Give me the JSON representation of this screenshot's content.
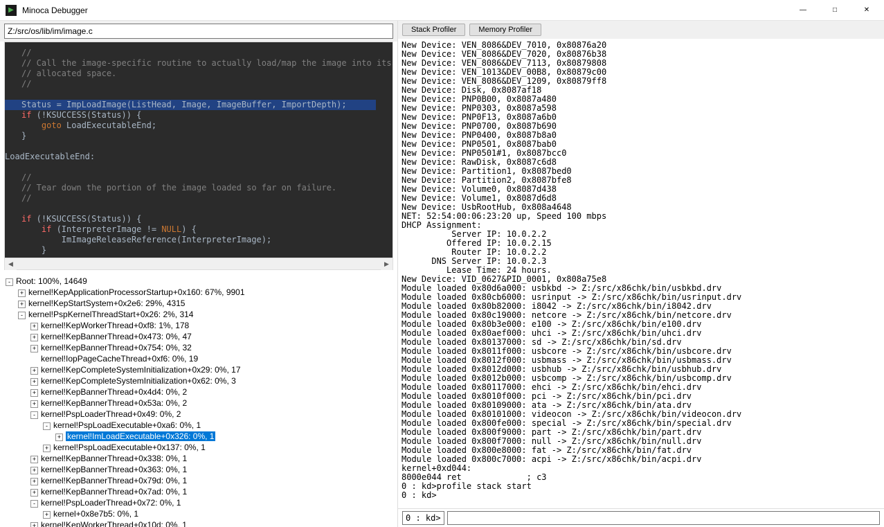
{
  "window": {
    "title": "Minoca Debugger",
    "icon_glyph": "▶"
  },
  "source": {
    "path": "Z:/src/os/lib/im/image.c"
  },
  "code_lines": [
    {
      "cls": "cm",
      "t": "//"
    },
    {
      "cls": "cm",
      "t": "// Call the image-specific routine to actually load/map the image into its"
    },
    {
      "cls": "cm",
      "t": "// allocated space."
    },
    {
      "cls": "cm",
      "t": "//"
    },
    {
      "cls": "",
      "t": ""
    },
    {
      "cls": "hl",
      "t": "Status = ImpLoadImage(ListHead, Image, ImageBuffer, ImportDepth);"
    },
    {
      "cls": "kw2",
      "t": "if (!KSUCCESS(Status)) {"
    },
    {
      "cls": "kw",
      "t": "    goto LoadExecutableEnd;"
    },
    {
      "cls": "",
      "t": "}"
    },
    {
      "cls": "",
      "t": ""
    },
    {
      "cls": "label",
      "t": "LoadExecutableEnd:"
    },
    {
      "cls": "",
      "t": ""
    },
    {
      "cls": "cm",
      "t": "//"
    },
    {
      "cls": "cm",
      "t": "// Tear down the portion of the image loaded so far on failure."
    },
    {
      "cls": "cm",
      "t": "//"
    },
    {
      "cls": "",
      "t": ""
    },
    {
      "cls": "kw2",
      "t": "if (!KSUCCESS(Status)) {"
    },
    {
      "cls": "kw2",
      "t": "    if (InterpreterImage != NULL) {"
    },
    {
      "cls": "",
      "t": "        ImImageReleaseReference(InterpreterImage);"
    },
    {
      "cls": "",
      "t": "    }"
    }
  ],
  "tree": [
    {
      "depth": 0,
      "toggle": "-",
      "label": "Root: 100%, 14649"
    },
    {
      "depth": 1,
      "toggle": "+",
      "label": "kernel!KepApplicationProcessorStartup+0x160: 67%, 9901"
    },
    {
      "depth": 1,
      "toggle": "+",
      "label": "kernel!KepStartSystem+0x2e6: 29%, 4315"
    },
    {
      "depth": 1,
      "toggle": "-",
      "label": "kernel!PspKernelThreadStart+0x26: 2%, 314"
    },
    {
      "depth": 2,
      "toggle": "+",
      "label": "kernel!KepWorkerThread+0xf8: 1%, 178"
    },
    {
      "depth": 2,
      "toggle": "+",
      "label": "kernel!KepBannerThread+0x473: 0%, 47"
    },
    {
      "depth": 2,
      "toggle": "+",
      "label": "kernel!KepBannerThread+0x754: 0%, 32"
    },
    {
      "depth": 2,
      "toggle": "",
      "label": "kernel!IopPageCacheThread+0xf6: 0%, 19"
    },
    {
      "depth": 2,
      "toggle": "+",
      "label": "kernel!KepCompleteSystemInitialization+0x29: 0%, 17"
    },
    {
      "depth": 2,
      "toggle": "+",
      "label": "kernel!KepCompleteSystemInitialization+0x62: 0%, 3"
    },
    {
      "depth": 2,
      "toggle": "+",
      "label": "kernel!KepBannerThread+0x4d4: 0%, 2"
    },
    {
      "depth": 2,
      "toggle": "+",
      "label": "kernel!KepBannerThread+0x53a: 0%, 2"
    },
    {
      "depth": 2,
      "toggle": "-",
      "label": "kernel!PspLoaderThread+0x49: 0%, 2"
    },
    {
      "depth": 3,
      "toggle": "-",
      "label": "kernel!PspLoadExecutable+0xa6: 0%, 1"
    },
    {
      "depth": 4,
      "toggle": "+",
      "label": "kernel!ImLoadExecutable+0x326: 0%, 1",
      "sel": true
    },
    {
      "depth": 3,
      "toggle": "+",
      "label": "kernel!PspLoadExecutable+0x137: 0%, 1"
    },
    {
      "depth": 2,
      "toggle": "+",
      "label": "kernel!KepBannerThread+0x338: 0%, 1"
    },
    {
      "depth": 2,
      "toggle": "+",
      "label": "kernel!KepBannerThread+0x363: 0%, 1"
    },
    {
      "depth": 2,
      "toggle": "+",
      "label": "kernel!KepBannerThread+0x79d: 0%, 1"
    },
    {
      "depth": 2,
      "toggle": "+",
      "label": "kernel!KepBannerThread+0x7ad: 0%, 1"
    },
    {
      "depth": 2,
      "toggle": "-",
      "label": "kernel!PspLoaderThread+0x72: 0%, 1"
    },
    {
      "depth": 3,
      "toggle": "+",
      "label": "kernel+0x8e7b5: 0%, 1"
    },
    {
      "depth": 2,
      "toggle": "+",
      "label": "kernel!KepWorkerThread+0x10d: 0%, 1"
    }
  ],
  "toolbar": {
    "stack_profiler": "Stack Profiler",
    "memory_profiler": "Memory Profiler"
  },
  "console_lines": [
    "New Device: VEN_8086&DEV_7010, 0x80876a20",
    "New Device: VEN_8086&DEV_7020, 0x80876b38",
    "New Device: VEN_8086&DEV_7113, 0x80879808",
    "New Device: VEN_1013&DEV_00B8, 0x80879c00",
    "New Device: VEN_8086&DEV_1209, 0x80879ff8",
    "New Device: Disk, 0x8087af18",
    "New Device: PNP0B00, 0x8087a480",
    "New Device: PNP0303, 0x8087a598",
    "New Device: PNP0F13, 0x8087a6b0",
    "New Device: PNP0700, 0x8087b690",
    "New Device: PNP0400, 0x8087b8a0",
    "New Device: PNP0501, 0x8087bab0",
    "New Device: PNP0501#1, 0x8087bcc0",
    "New Device: RawDisk, 0x8087c6d8",
    "New Device: Partition1, 0x8087bed0",
    "New Device: Partition2, 0x8087bfe8",
    "New Device: Volume0, 0x8087d438",
    "New Device: Volume1, 0x8087d6d8",
    "New Device: UsbRootHub, 0x808a4648",
    "NET: 52:54:00:06:23:20 up, Speed 100 mbps",
    "DHCP Assignment:",
    "          Server IP: 10.0.2.2",
    "         Offered IP: 10.0.2.15",
    "          Router IP: 10.0.2.2",
    "      DNS Server IP: 10.0.2.3",
    "         Lease Time: 24 hours.",
    "New Device: VID_0627&PID_0001, 0x808a75e8",
    "Module loaded 0x80d6a000: usbkbd -> Z:/src/x86chk/bin/usbkbd.drv",
    "Module loaded 0x80cb6000: usrinput -> Z:/src/x86chk/bin/usrinput.drv",
    "Module loaded 0x80b82000: i8042 -> Z:/src/x86chk/bin/i8042.drv",
    "Module loaded 0x80c19000: netcore -> Z:/src/x86chk/bin/netcore.drv",
    "Module loaded 0x80b3e000: e100 -> Z:/src/x86chk/bin/e100.drv",
    "Module loaded 0x80aef000: uhci -> Z:/src/x86chk/bin/uhci.drv",
    "Module loaded 0x80137000: sd -> Z:/src/x86chk/bin/sd.drv",
    "Module loaded 0x8011f000: usbcore -> Z:/src/x86chk/bin/usbcore.drv",
    "Module loaded 0x8012f000: usbmass -> Z:/src/x86chk/bin/usbmass.drv",
    "Module loaded 0x8012d000: usbhub -> Z:/src/x86chk/bin/usbhub.drv",
    "Module loaded 0x8012b000: usbcomp -> Z:/src/x86chk/bin/usbcomp.drv",
    "Module loaded 0x80117000: ehci -> Z:/src/x86chk/bin/ehci.drv",
    "Module loaded 0x8010f000: pci -> Z:/src/x86chk/bin/pci.drv",
    "Module loaded 0x80109000: ata -> Z:/src/x86chk/bin/ata.drv",
    "Module loaded 0x80101000: videocon -> Z:/src/x86chk/bin/videocon.drv",
    "Module loaded 0x800fe000: special -> Z:/src/x86chk/bin/special.drv",
    "Module loaded 0x800f9000: part -> Z:/src/x86chk/bin/part.drv",
    "Module loaded 0x800f7000: null -> Z:/src/x86chk/bin/null.drv",
    "Module loaded 0x800e8000: fat -> Z:/src/x86chk/bin/fat.drv",
    "Module loaded 0x800c7000: acpi -> Z:/src/x86chk/bin/acpi.drv",
    "kernel+0xd044:",
    "8000e044 ret             ; c3",
    "0 : kd>profile stack start",
    "0 : kd>"
  ],
  "cmd": {
    "prompt": "0 : kd>",
    "value": ""
  }
}
